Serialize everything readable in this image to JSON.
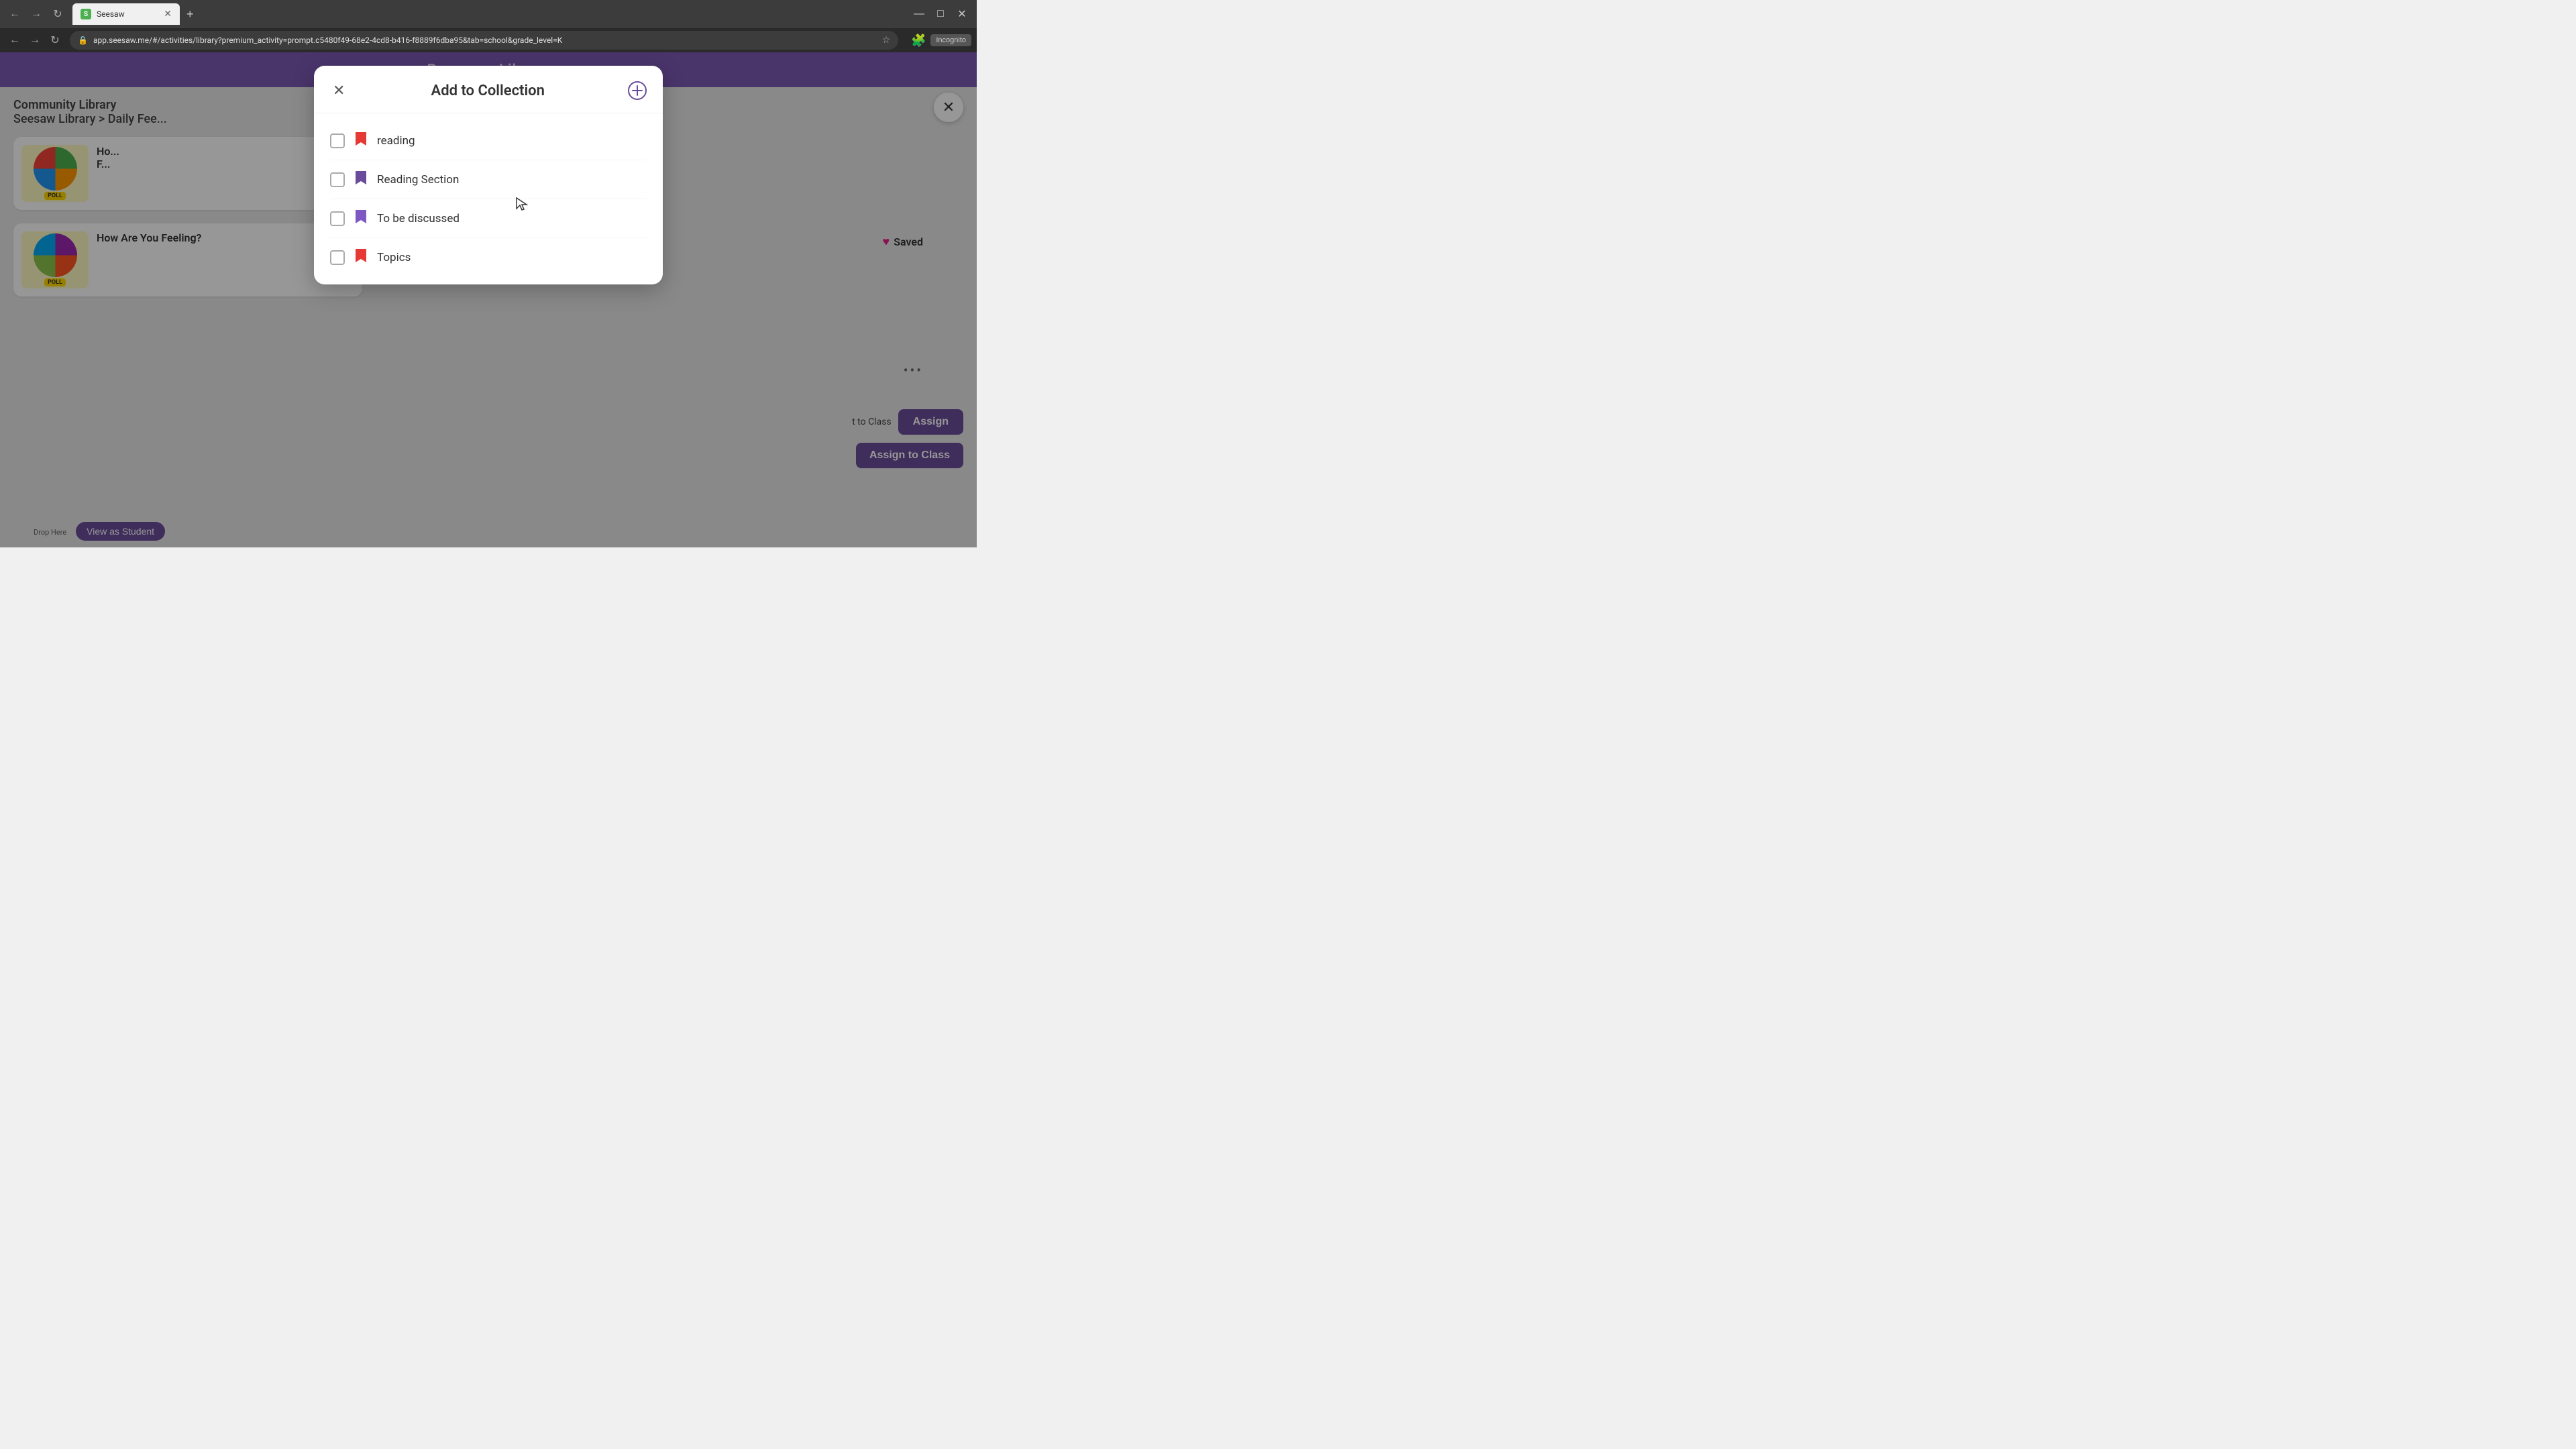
{
  "browser": {
    "tab_label": "Seesaw",
    "tab_favicon": "S",
    "url": "app.seesaw.me/#/activities/library?premium_activity=prompt.c5480f49-68e2-4cd8-b416-f8889f6dba95&tab=school&grade_level=K",
    "incognito_label": "Incognito",
    "nav": {
      "back": "←",
      "forward": "→",
      "refresh": "↻"
    },
    "window_controls": {
      "minimize": "—",
      "restore": "□",
      "close": "✕"
    }
  },
  "page": {
    "header_title": "Resource Library",
    "breadcrumb": "Seesaw Library > Daily Fee...",
    "community_library": "Community Library",
    "close_overlay": "✕"
  },
  "cards": [
    {
      "title": "Ho...\nF...",
      "thumb_type": "poll"
    },
    {
      "title": "How Are You Feeling?",
      "subtitle": ""
    }
  ],
  "right_panel": {
    "saved_label": "Saved",
    "saved_icon": "♥",
    "more_dots": "•••",
    "assign_btn_label": "Assign",
    "to_class_label": "t to Class",
    "assign_to_class_label": "Assign to Class"
  },
  "footer": {
    "drop_here": "Drop Here",
    "view_as_student": "View as Student"
  },
  "modal": {
    "title": "Add to Collection",
    "close_btn": "✕",
    "add_btn": "⊕",
    "collections": [
      {
        "name": "reading",
        "bookmark_color": "red",
        "checked": false
      },
      {
        "name": "Reading Section",
        "bookmark_color": "purple-dark",
        "checked": false
      },
      {
        "name": "To be discussed",
        "bookmark_color": "purple-mid",
        "checked": false
      },
      {
        "name": "Topics",
        "bookmark_color": "red",
        "checked": false
      }
    ]
  }
}
